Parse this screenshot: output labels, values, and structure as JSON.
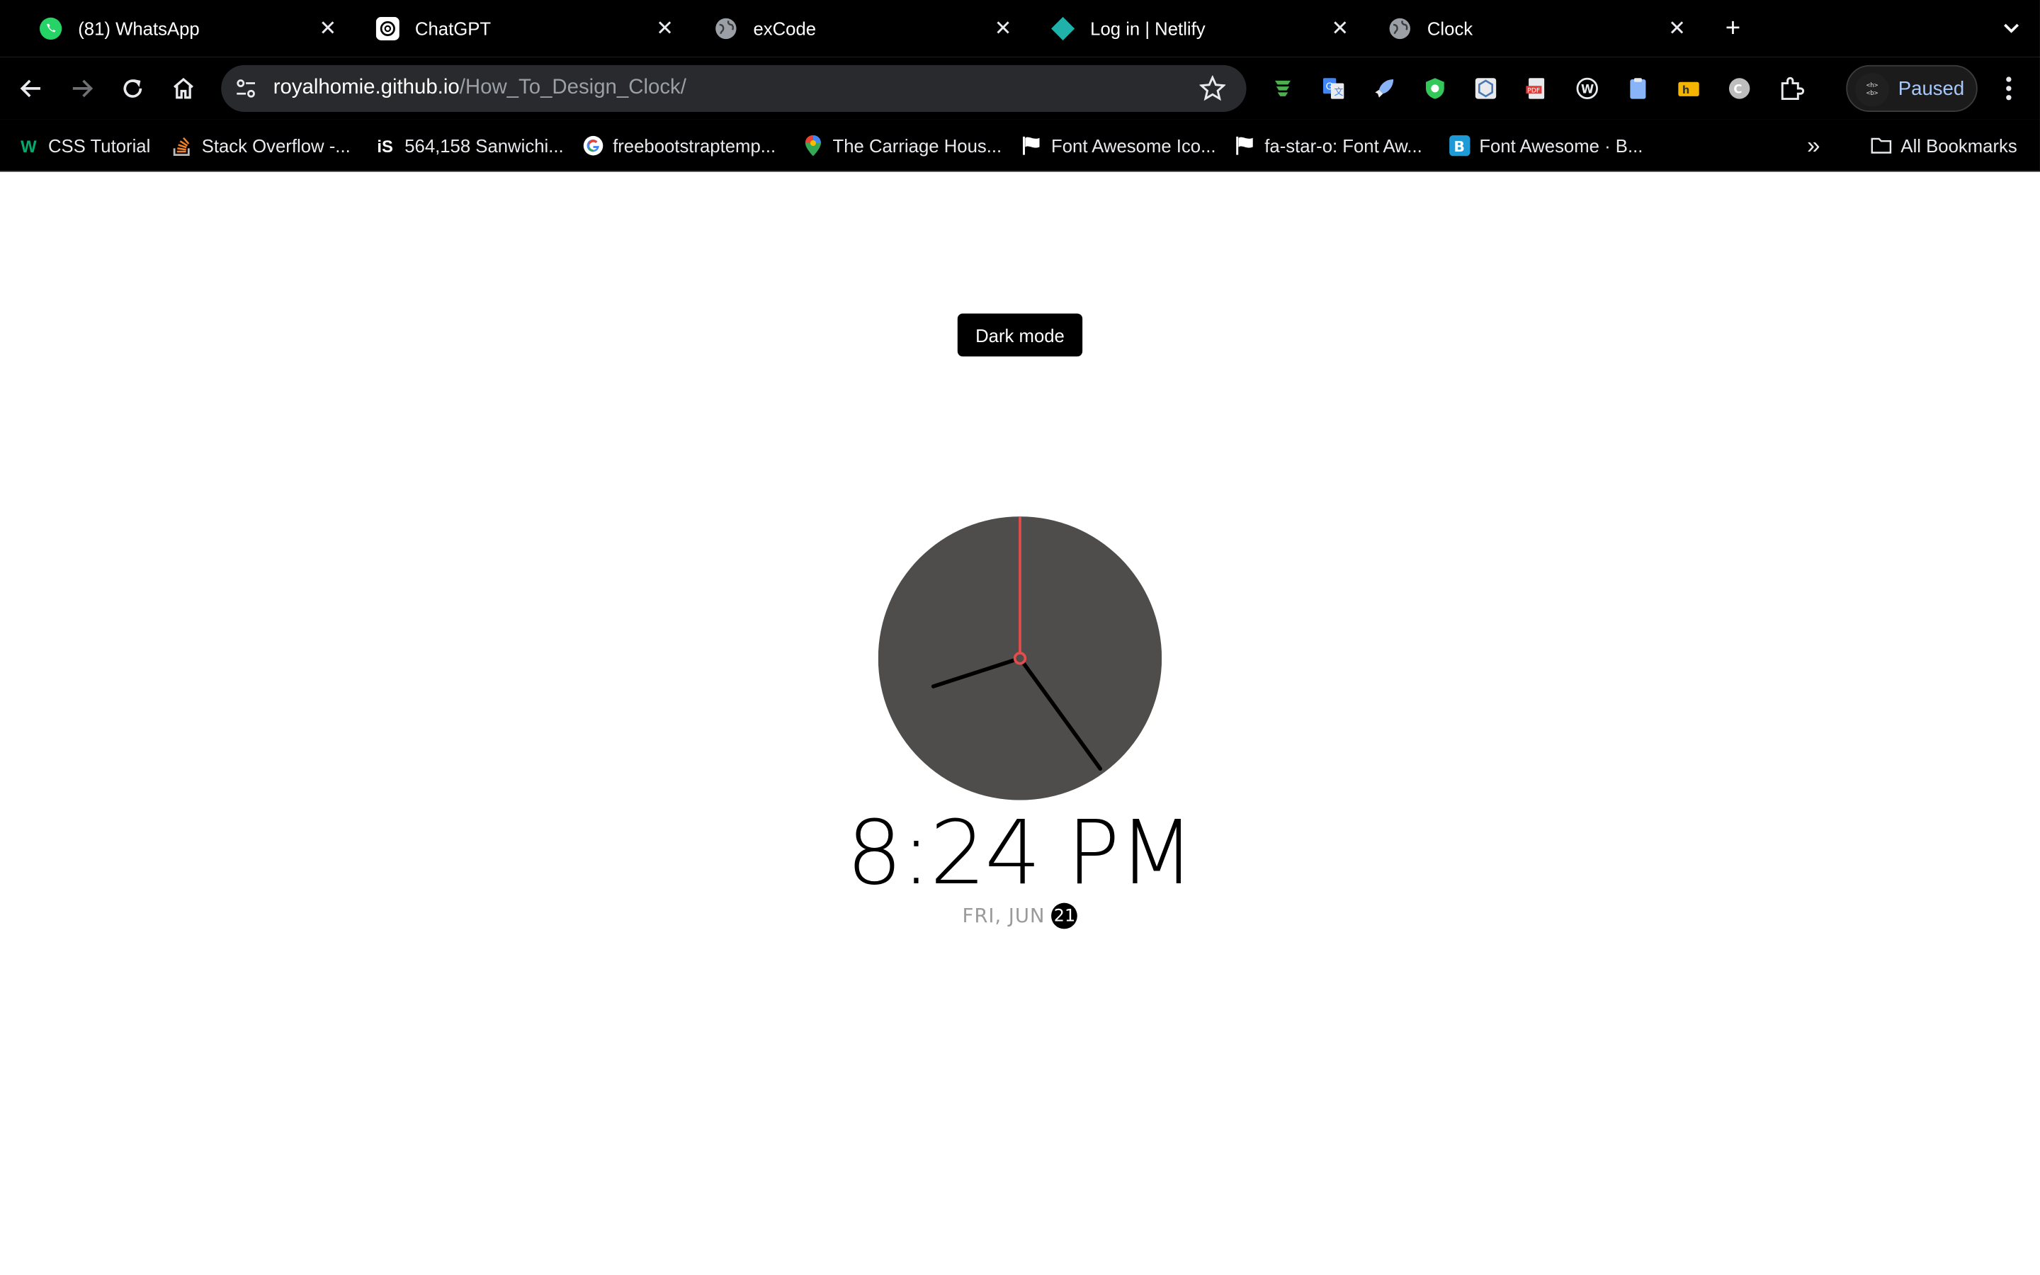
{
  "tabs": [
    {
      "title": "(81) WhatsApp",
      "icon": "whatsapp-icon"
    },
    {
      "title": "ChatGPT",
      "icon": "chatgpt-icon"
    },
    {
      "title": "exCode",
      "icon": "globe-icon"
    },
    {
      "title": "Log in | Netlify",
      "icon": "netlify-icon"
    },
    {
      "title": "Clock",
      "icon": "globe-icon",
      "active": true
    }
  ],
  "toolbar": {
    "url_host": "royalhomie.github.io",
    "url_path": "/How_To_Design_Clock/",
    "profile_status": "Paused",
    "extensions": [
      "wappalyzer-icon",
      "google-translate-icon",
      "rocket-icon",
      "shield-icon",
      "cube-icon",
      "pdf-icon",
      "w-icon",
      "clipboard-icon",
      "folder-icon",
      "c-icon",
      "puzzle-icon"
    ]
  },
  "bookmarks": [
    {
      "label": "CSS Tutorial",
      "icon": "w3schools-icon"
    },
    {
      "label": "Stack Overflow -...",
      "icon": "stackoverflow-icon"
    },
    {
      "label": "564,158 Sanwichi...",
      "icon": "istock-icon"
    },
    {
      "label": "freebootstraptemp...",
      "icon": "google-icon"
    },
    {
      "label": "The Carriage Hous...",
      "icon": "maps-pin-icon"
    },
    {
      "label": "Font Awesome Ico...",
      "icon": "flag-icon"
    },
    {
      "label": "fa-star-o: Font Aw...",
      "icon": "flag-icon"
    },
    {
      "label": "Font Awesome · B...",
      "icon": "bootstrap-icon"
    }
  ],
  "all_bookmarks_label": "All Bookmarks",
  "page": {
    "dark_mode_label": "Dark mode",
    "time": "8:24 PM",
    "date_prefix": "FRI, JUN",
    "day": "21",
    "clock": {
      "hour": 8,
      "minute": 24,
      "second": 0
    },
    "colors": {
      "face": "#4f4d4b",
      "second_hand": "#e74c4c",
      "hands": "#000000"
    }
  }
}
